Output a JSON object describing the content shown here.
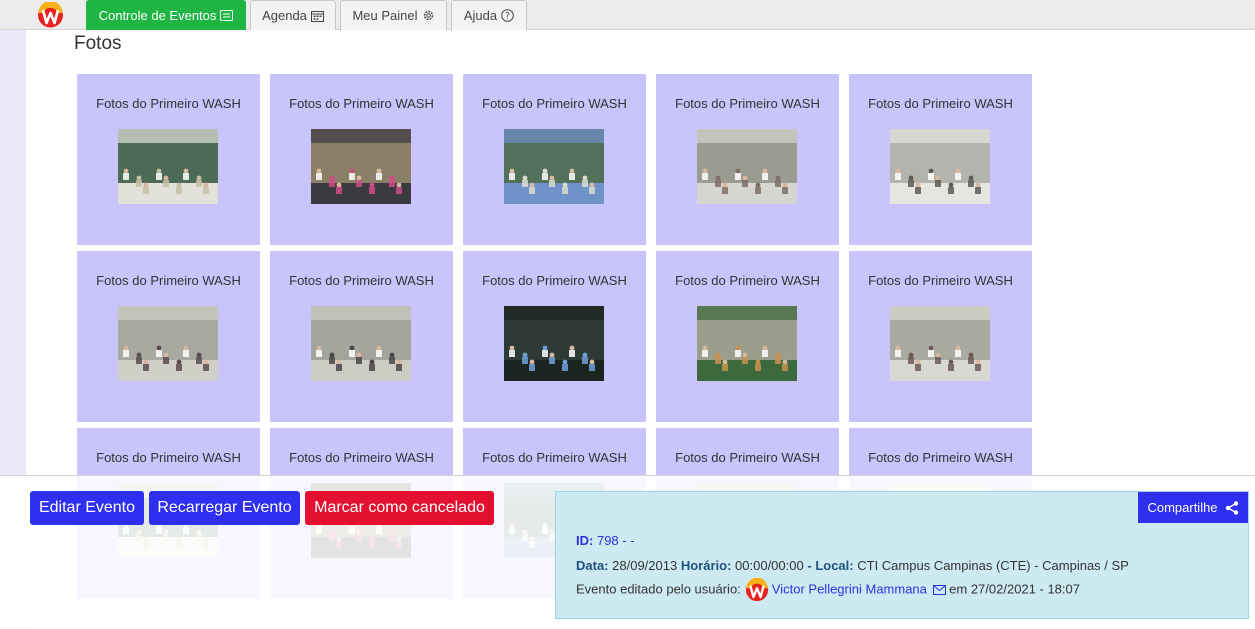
{
  "nav": {
    "tabs": [
      {
        "label": "Controle de Eventos",
        "icon": "list-card-icon",
        "active": true
      },
      {
        "label": "Agenda",
        "icon": "calendar-icon",
        "active": false
      },
      {
        "label": "Meu Painel",
        "icon": "gear-icon",
        "active": false
      },
      {
        "label": "Ajuda",
        "icon": "question-icon",
        "active": false
      }
    ]
  },
  "section_title": "Fotos",
  "gallery": {
    "caption": "Fotos do Primeiro WASH",
    "rows_visible": 3,
    "columns": 5
  },
  "actions": {
    "edit": "Editar Evento",
    "reload": "Recarregar Evento",
    "cancel": "Marcar como cancelado"
  },
  "event": {
    "share_label": "Compartilhe",
    "id_label": "ID:",
    "id_value": "798 - -",
    "date_label": "Data:",
    "date_value": "28/09/2013",
    "time_label": "Horário:",
    "time_value": "00:00/00:00",
    "local_label": "Local:",
    "local_value": "CTI Campus Campinas (CTE) - Campinas / SP",
    "edited_prefix": "Evento editado pelo usuário:",
    "editor_name": "Victor Pellegrini Mammana",
    "edited_suffix": "em 27/02/2021 - 18:07"
  },
  "colors": {
    "active_tab": "#1fb543",
    "card_bg": "#c9c4fb",
    "button_blue": "#2f2ff0",
    "button_red": "#e41030",
    "info_bg": "#cdeaf3"
  }
}
